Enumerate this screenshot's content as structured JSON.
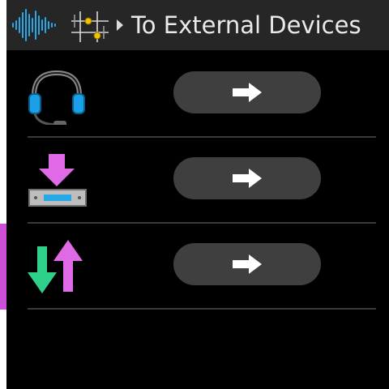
{
  "header": {
    "title": "To External Devices",
    "icons": [
      "waveform-icon",
      "eq-grid-icon",
      "breadcrumb-arrow-icon"
    ]
  },
  "rows": [
    {
      "icon": "headset-icon",
      "button_icon": "right-arrow-icon",
      "selected": false
    },
    {
      "icon": "download-to-device-icon",
      "button_icon": "right-arrow-icon",
      "selected": false
    },
    {
      "icon": "up-down-arrows-icon",
      "button_icon": "right-arrow-icon",
      "selected": true
    }
  ],
  "colors": {
    "header_bg": "#262626",
    "screen_bg": "#000000",
    "button_bg": "#3f3f3f",
    "selection": "#cc4fd8",
    "waveform": "#29a8e8",
    "magenta": "#e066e8",
    "green": "#2fd08a"
  }
}
